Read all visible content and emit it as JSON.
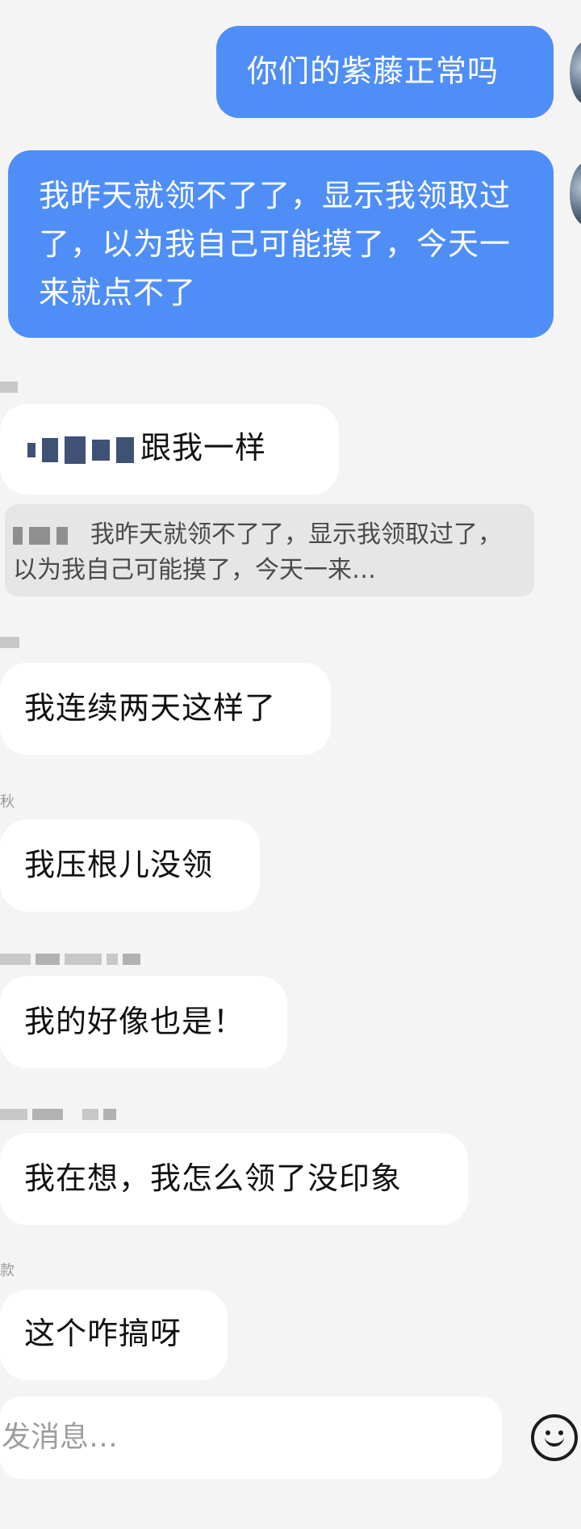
{
  "messages": [
    {
      "text": "你们的紫藤正常吗"
    },
    {
      "text": "我昨天就领不了了，显示我领取过了，以为我自己可能摸了，今天一来就点不了"
    },
    {
      "text": "跟我一样"
    },
    {
      "text": "我连续两天这样了"
    },
    {
      "text": "我压根儿没领"
    },
    {
      "text": "我的好像也是！"
    },
    {
      "text": "我在想，我怎么领了没印象"
    },
    {
      "text": "这个咋搞呀"
    }
  ],
  "quote": {
    "text": "我昨天就领不了了，显示我领取过了，以为我自己可能摸了，今天一来…"
  },
  "sender_fragments": {
    "m5": "秋",
    "m8": "款"
  },
  "composer": {
    "placeholder": "发消息…"
  },
  "icons": {
    "emoji": "smiley-face-icon"
  },
  "colors": {
    "my_bubble": "#4f8ef7",
    "their_bubble": "#ffffff",
    "background": "#f4f4f4"
  }
}
